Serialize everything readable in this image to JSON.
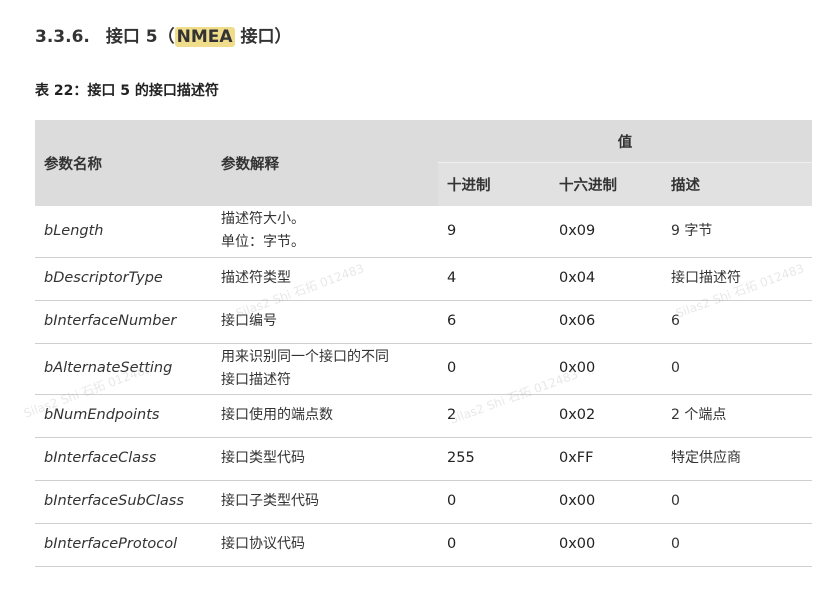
{
  "section": {
    "number": "3.3.6.",
    "title_before": "接口 5（",
    "title_highlight": "NMEA",
    "title_after": " 接口）"
  },
  "table_caption": "表 22：接口 5 的接口描述符",
  "table": {
    "headers": {
      "param": "参数名称",
      "explain": "参数解释",
      "value": "值",
      "dec": "十进制",
      "hex": "十六进制",
      "desc": "描述"
    },
    "rows": [
      {
        "param": "bLength",
        "explain_lines": [
          "描述符大小。",
          "单位：字节。"
        ],
        "dec": "9",
        "hex": "0x09",
        "desc": "9 字节"
      },
      {
        "param": "bDescriptorType",
        "explain_lines": [
          "描述符类型"
        ],
        "dec": "4",
        "hex": "0x04",
        "desc": "接口描述符"
      },
      {
        "param": "bInterfaceNumber",
        "explain_lines": [
          "接口编号"
        ],
        "dec": "6",
        "hex": "0x06",
        "desc": "6"
      },
      {
        "param": "bAlternateSetting",
        "explain_lines": [
          "用来识别同一个接口的不同",
          "接口描述符"
        ],
        "dec": "0",
        "hex": "0x00",
        "desc": "0"
      },
      {
        "param": "bNumEndpoints",
        "explain_lines": [
          "接口使用的端点数"
        ],
        "dec": "2",
        "hex": "0x02",
        "desc": "2 个端点"
      },
      {
        "param": "bInterfaceClass",
        "explain_lines": [
          "接口类型代码"
        ],
        "dec": "255",
        "hex": "0xFF",
        "desc": "特定供应商"
      },
      {
        "param": "bInterfaceSubClass",
        "explain_lines": [
          "接口子类型代码"
        ],
        "dec": "0",
        "hex": "0x00",
        "desc": "0"
      },
      {
        "param": "bInterfaceProtocol",
        "explain_lines": [
          "接口协议代码"
        ],
        "dec": "0",
        "hex": "0x00",
        "desc": "0"
      }
    ]
  },
  "watermarks": [
    "Silas2 Shi 石拓 012483",
    "Silas2 Shi 石拓 012483",
    "Silas2 Shi 石拓 012483",
    "Silas2 Shi 石拓 012483"
  ]
}
